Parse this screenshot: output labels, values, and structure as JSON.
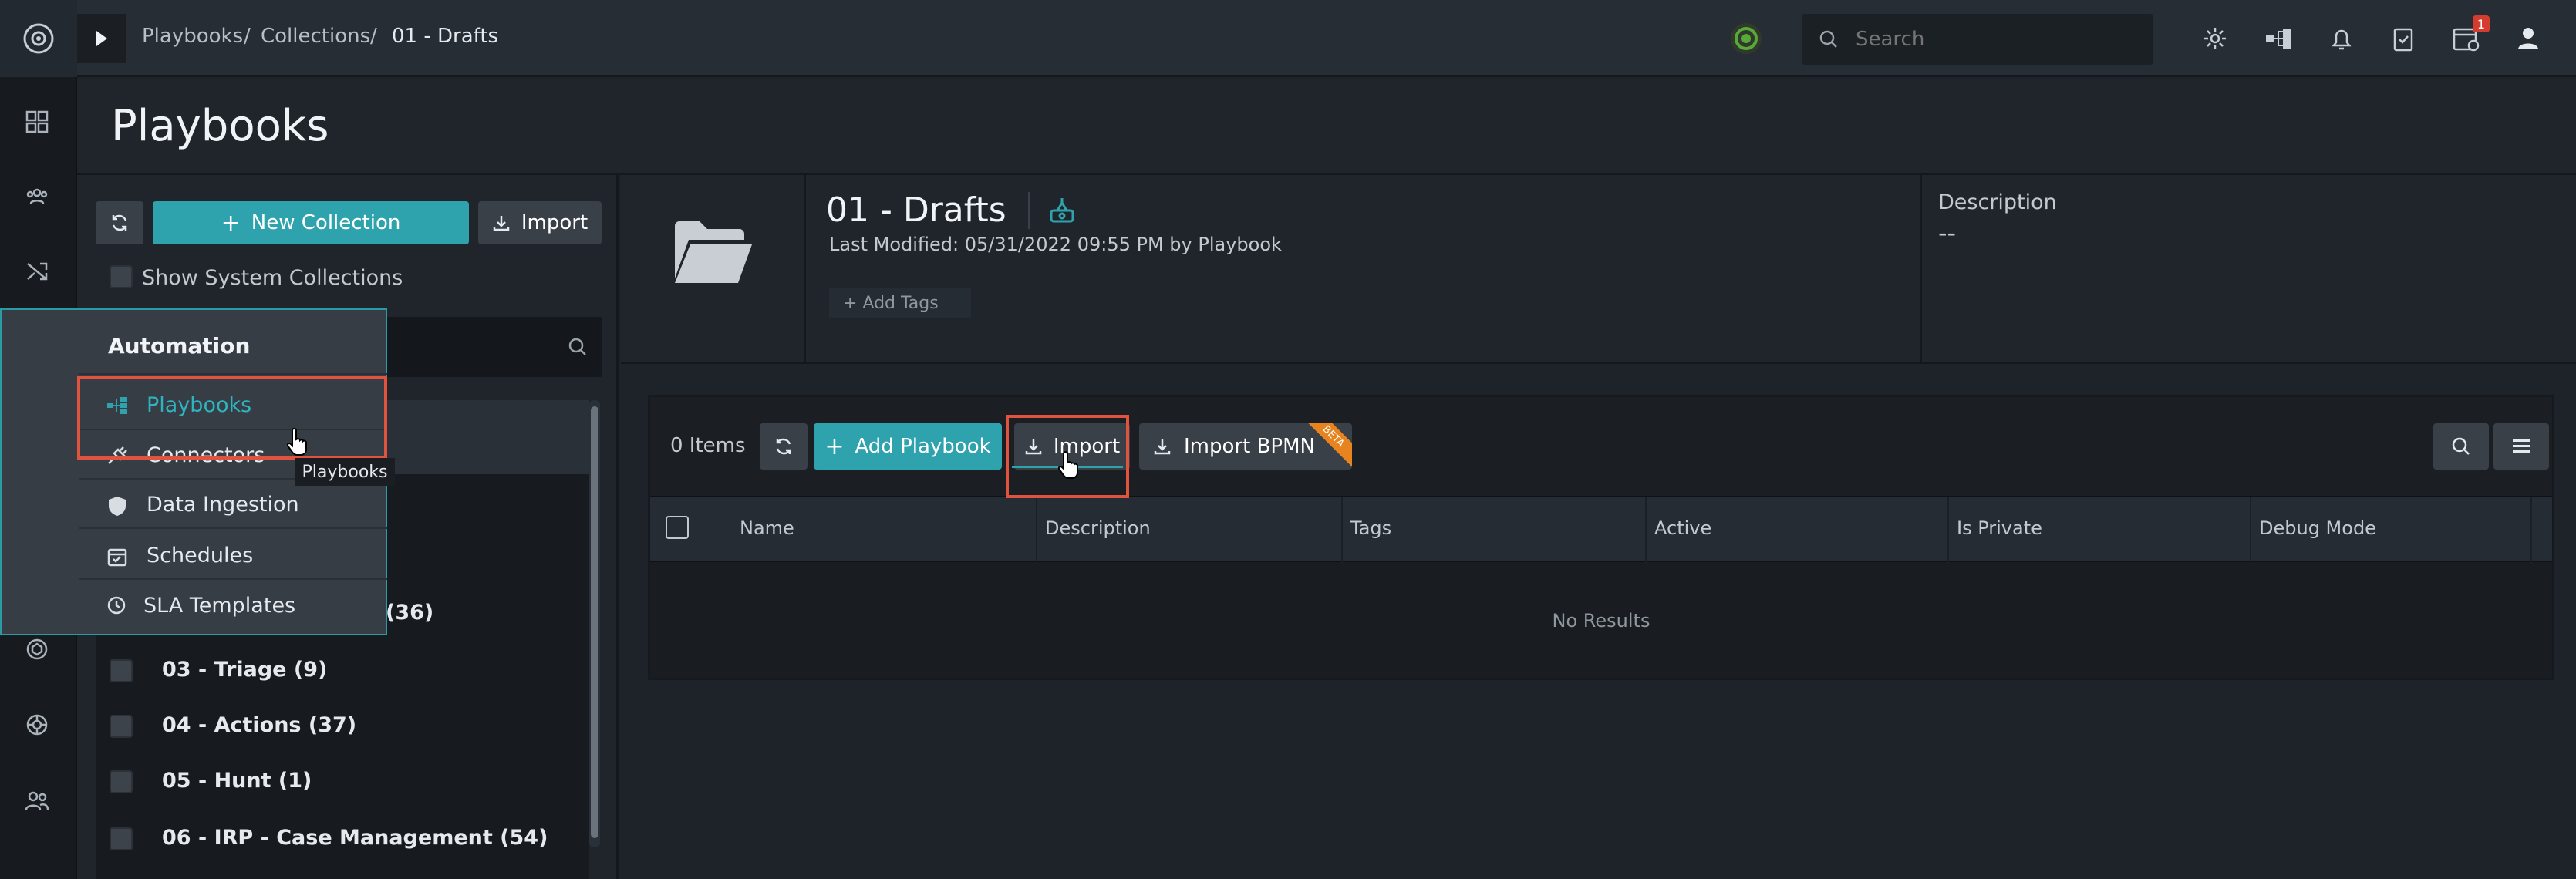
{
  "breadcrumb": [
    "Playbooks",
    "Collections",
    "01 - Drafts"
  ],
  "breadcrumb_sep": "/",
  "search": {
    "placeholder": "Search"
  },
  "notification_badge": "1",
  "page_title": "Playbooks",
  "left_panel": {
    "new_collection_label": "New Collection",
    "import_label": "Import",
    "show_system_label": "Show System Collections",
    "tree_items": [
      {
        "label": "(36)"
      },
      {
        "label": "03 - Triage (9)"
      },
      {
        "label": "04 - Actions (37)"
      },
      {
        "label": "05 - Hunt (1)"
      },
      {
        "label": "06 - IRP - Case Management (54)"
      }
    ]
  },
  "menu": {
    "header": "Automation",
    "items": [
      {
        "label": "Playbooks",
        "active": true
      },
      {
        "label": "Connectors"
      },
      {
        "label": "Data Ingestion"
      },
      {
        "label": "Schedules"
      },
      {
        "label": "SLA Templates"
      }
    ],
    "tooltip": "Playbooks"
  },
  "collection": {
    "title": "01 - Drafts",
    "last_modified": "Last Modified: 05/31/2022 09:55 PM by Playbook",
    "add_tags": "+ Add Tags",
    "description_label": "Description",
    "description_value": "--"
  },
  "grid": {
    "count_label": "0 Items",
    "add_playbook_label": "Add Playbook",
    "import_label": "Import",
    "import_bpmn_label": "Import BPMN",
    "beta_label": "BETA",
    "columns": [
      "Name",
      "Description",
      "Tags",
      "Active",
      "Is Private",
      "Debug Mode"
    ],
    "empty_text": "No Results"
  },
  "colors": {
    "accent": "#2fa3ad",
    "highlight_box": "#e0533f",
    "beta": "#e8841f"
  }
}
